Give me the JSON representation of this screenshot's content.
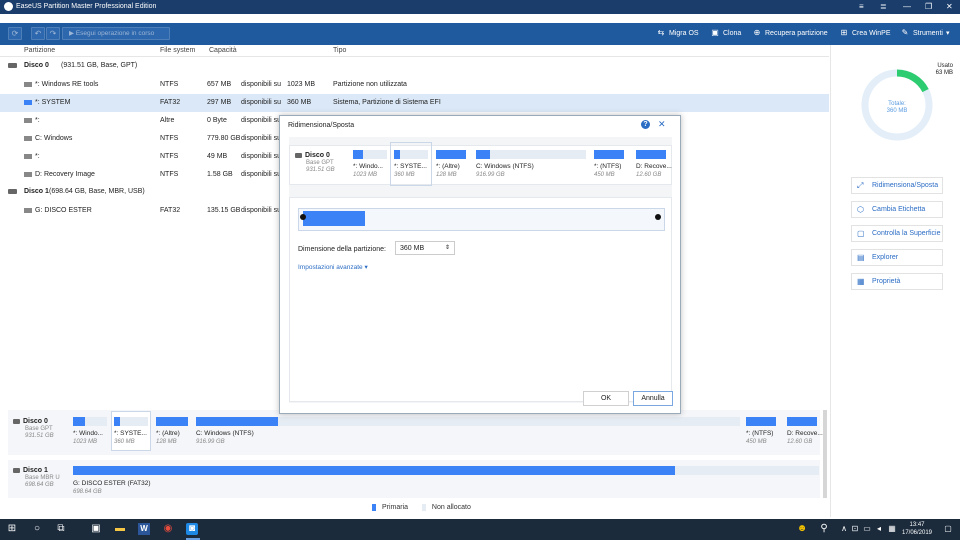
{
  "window": {
    "title": "EaseUS Partition Master Professional Edition"
  },
  "toolbar": {
    "pending_label": "Esegui operazione in corso",
    "links": [
      "Migra OS",
      "Clona",
      "Recupera partizione",
      "Crea WinPE",
      "Strumenti"
    ]
  },
  "columns": [
    "Partizione",
    "File system",
    "Capacità",
    "Tipo"
  ],
  "disks": [
    {
      "name": "Disco 0",
      "info": "(931.51 GB, Base, GPT)"
    },
    {
      "name": "Disco 1",
      "info": "(698.64 GB, Base, MBR, USB)"
    }
  ],
  "partitions": [
    {
      "name": "*: Windows RE tools",
      "fs": "NTFS",
      "size": "657 MB",
      "avail": "disponibili su",
      "total": "1023 MB",
      "type": "Partizione non utilizzata"
    },
    {
      "name": "*: SYSTEM",
      "fs": "FAT32",
      "size": "297 MB",
      "avail": "disponibili su",
      "total": "360 MB",
      "type": "Sistema, Partizione di Sistema EFI"
    },
    {
      "name": "*:",
      "fs": "Altre",
      "size": "0 Byte",
      "avail": "disponibili su"
    },
    {
      "name": "C: Windows",
      "fs": "NTFS",
      "size": "779.80 GB",
      "avail": "disponibili su"
    },
    {
      "name": "*:",
      "fs": "NTFS",
      "size": "49 MB",
      "avail": "disponibili su"
    },
    {
      "name": "D: Recovery Image",
      "fs": "NTFS",
      "size": "1.58 GB",
      "avail": "disponibili su"
    },
    {
      "name": "G: DISCO ESTER",
      "fs": "FAT32",
      "size": "135.15 GB",
      "avail": "disponibili su"
    }
  ],
  "usage": {
    "used_label": "Usato",
    "used_value": "63 MB",
    "total_label": "Totale:",
    "total_value": "360 MB",
    "fraction": 0.175
  },
  "actions": [
    "Ridimensiona/Sposta",
    "Cambia Etichetta",
    "Controlla la Superficie",
    "Explorer",
    "Proprietà"
  ],
  "dialog": {
    "title": "Ridimensiona/Sposta",
    "disk_name": "Disco 0",
    "disk_type": "Base GPT",
    "disk_size": "931.51 GB",
    "segments": [
      {
        "name": "*: Windo...",
        "size": "1023 MB"
      },
      {
        "name": "*: SYSTE...",
        "size": "360 MB"
      },
      {
        "name": "*: (Altre)",
        "size": "128 MB"
      },
      {
        "name": "C: Windows (NTFS)",
        "size": "916.99 GB"
      },
      {
        "name": "*: (NTFS)",
        "size": "450 MB"
      },
      {
        "name": "D: Recove...",
        "size": "12.60 GB"
      }
    ],
    "size_label": "Dimensione della partizione:",
    "size_value": "360 MB",
    "advanced": "Impostazioni avanzate",
    "ok": "OK",
    "cancel": "Annulla"
  },
  "diskmap": [
    {
      "name": "Disco 0",
      "type": "Base GPT",
      "size": "931.51 GB"
    },
    {
      "name": "Disco 1",
      "type": "Base MBR U",
      "size": "698.64 GB",
      "part_name": "G: DISCO ESTER (FAT32)",
      "part_size": "698.64 GB"
    }
  ],
  "legend": {
    "primary": "Primaria",
    "unalloc": "Non allocato"
  },
  "taskbar": {
    "time": "13:47",
    "date": "17/06/2019"
  },
  "colors": {
    "accent": "#3b82f6",
    "title": "#1a3d6b",
    "toolbar": "#205a9e",
    "usage_ring": "#2ecc71"
  }
}
